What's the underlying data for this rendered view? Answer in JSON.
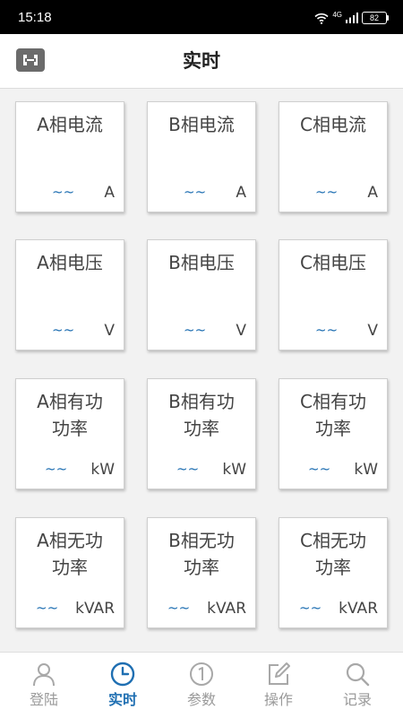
{
  "status_bar": {
    "time": "15:18",
    "network": "4G",
    "battery": "82",
    "icons": [
      "wifi-icon",
      "signal-icon",
      "battery-icon"
    ]
  },
  "header": {
    "title": "实时",
    "logo_icon": "device-logo-icon"
  },
  "colors": {
    "accent": "#1f6fb2",
    "text": "#444444",
    "inactive": "#9a9a9a",
    "background": "#f2f2f2"
  },
  "cards": [
    {
      "title": "A相电流",
      "value": "~~",
      "unit": "A"
    },
    {
      "title": "B相电流",
      "value": "~~",
      "unit": "A"
    },
    {
      "title": "C相电流",
      "value": "~~",
      "unit": "A"
    },
    {
      "title": "A相电压",
      "value": "~~",
      "unit": "V"
    },
    {
      "title": "B相电压",
      "value": "~~",
      "unit": "V"
    },
    {
      "title": "C相电压",
      "value": "~~",
      "unit": "V"
    },
    {
      "title": "A相有功\n功率",
      "value": "~~",
      "unit": "kW"
    },
    {
      "title": "B相有功\n功率",
      "value": "~~",
      "unit": "kW"
    },
    {
      "title": "C相有功\n功率",
      "value": "~~",
      "unit": "kW"
    },
    {
      "title": "A相无功\n功率",
      "value": "~~",
      "unit": "kVAR"
    },
    {
      "title": "B相无功\n功率",
      "value": "~~",
      "unit": "kVAR"
    },
    {
      "title": "C相无功\n功率",
      "value": "~~",
      "unit": "kVAR"
    }
  ],
  "tabs": [
    {
      "label": "登陆",
      "icon": "person-icon",
      "active": false
    },
    {
      "label": "实时",
      "icon": "clock-icon",
      "active": true
    },
    {
      "label": "参数",
      "icon": "number-one-icon",
      "active": false
    },
    {
      "label": "操作",
      "icon": "edit-icon",
      "active": false
    },
    {
      "label": "记录",
      "icon": "search-icon",
      "active": false
    }
  ]
}
